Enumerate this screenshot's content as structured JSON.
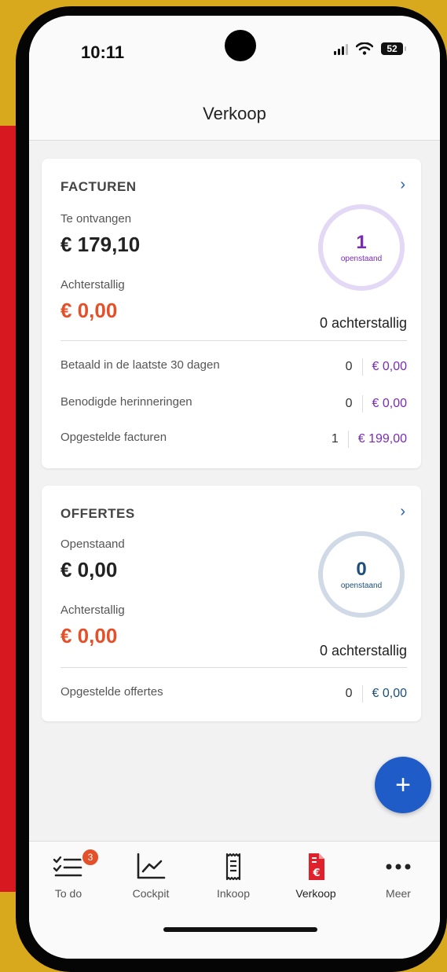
{
  "status_bar": {
    "time": "10:11",
    "battery": "52"
  },
  "header": {
    "title": "Verkoop"
  },
  "facturen": {
    "title": "FACTUREN",
    "receivable_label": "Te ontvangen",
    "receivable_amount": "€ 179,10",
    "overdue_label": "Achterstallig",
    "overdue_amount": "€ 0,00",
    "open_count": "1",
    "open_label": "openstaand",
    "overdue_count_text": "0 achterstallig",
    "rows": [
      {
        "label": "Betaald in de laatste 30 dagen",
        "count": "0",
        "amount": "€ 0,00"
      },
      {
        "label": "Benodigde herinneringen",
        "count": "0",
        "amount": "€ 0,00"
      },
      {
        "label": "Opgestelde facturen",
        "count": "1",
        "amount": "€ 199,00"
      }
    ]
  },
  "offertes": {
    "title": "OFFERTES",
    "open_label_top": "Openstaand",
    "open_amount": "€ 0,00",
    "overdue_label": "Achterstallig",
    "overdue_amount": "€ 0,00",
    "open_count": "0",
    "open_label": "openstaand",
    "overdue_count_text": "0 achterstallig",
    "rows": [
      {
        "label": "Opgestelde offertes",
        "count": "0",
        "amount": "€ 0,00"
      }
    ]
  },
  "fab": {
    "symbol": "+"
  },
  "tabbar": {
    "tabs": [
      {
        "label": "To do",
        "icon": "checklist-icon",
        "badge": "3"
      },
      {
        "label": "Cockpit",
        "icon": "chart-icon"
      },
      {
        "label": "Inkoop",
        "icon": "receipt-icon"
      },
      {
        "label": "Verkoop",
        "icon": "invoice-euro-icon"
      },
      {
        "label": "Meer",
        "icon": "more-icon"
      }
    ]
  },
  "colors": {
    "accent": "#1f5cc8",
    "overdue": "#e4502a",
    "invoice_amount": "#7a2ab8",
    "quote_amount": "#1c4f7a",
    "active_tab": "#e0202a"
  }
}
